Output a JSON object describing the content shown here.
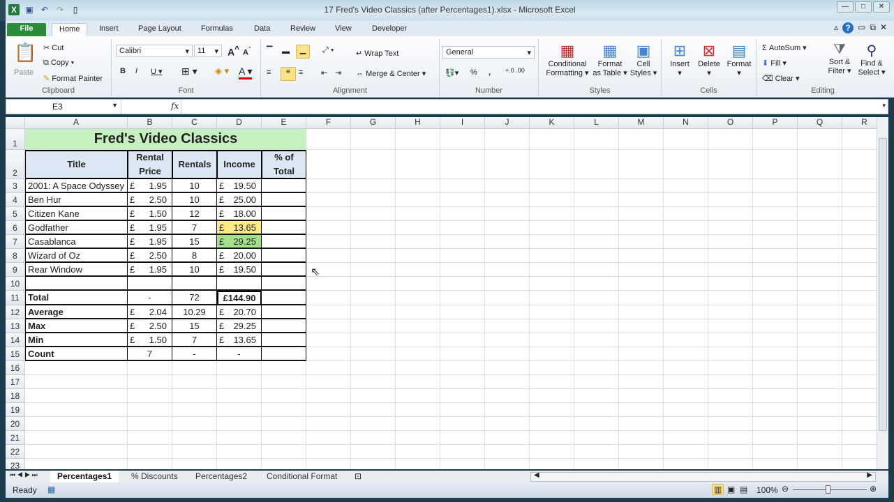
{
  "window": {
    "title": "17 Fred's Video Classics (after Percentages1).xlsx - Microsoft Excel"
  },
  "ribbon_tabs": [
    "File",
    "Home",
    "Insert",
    "Page Layout",
    "Formulas",
    "Data",
    "Review",
    "View",
    "Developer"
  ],
  "clipboard": {
    "paste": "Paste",
    "cut": "Cut",
    "copy": "Copy",
    "format_painter": "Format Painter",
    "label": "Clipboard"
  },
  "font": {
    "name": "Calibri",
    "size": "11",
    "label": "Font"
  },
  "alignment": {
    "wrap": "Wrap Text",
    "merge": "Merge & Center",
    "label": "Alignment"
  },
  "number": {
    "format": "General",
    "percent": "%",
    "comma": ",",
    "label": "Number"
  },
  "styles": {
    "conditional": "Conditional",
    "conditional2": "Formatting",
    "format_table": "Format",
    "format_table2": "as Table",
    "cell_styles": "Cell",
    "cell_styles2": "Styles",
    "label": "Styles"
  },
  "cells": {
    "insert": "Insert",
    "delete": "Delete",
    "format": "Format",
    "label": "Cells"
  },
  "editing": {
    "autosum": "AutoSum",
    "fill": "Fill",
    "clear": "Clear",
    "sort": "Sort &",
    "sort2": "Filter",
    "find": "Find &",
    "find2": "Select",
    "label": "Editing"
  },
  "formula_bar": {
    "name_box": "E3",
    "fx": "fx",
    "value": ""
  },
  "columns": [
    "A",
    "B",
    "C",
    "D",
    "E",
    "F",
    "G",
    "H",
    "I",
    "J",
    "K",
    "L",
    "M",
    "N",
    "O",
    "P",
    "Q",
    "R"
  ],
  "currency": "£",
  "sheet": {
    "title": "Fred's Video Classics",
    "headers": [
      "Title",
      "Rental Price",
      "Rentals",
      "Income",
      "% of Total"
    ],
    "rows": [
      [
        "2001: A Space Odyssey",
        "1.95",
        "10",
        "19.50",
        ""
      ],
      [
        "Ben Hur",
        "2.50",
        "10",
        "25.00",
        ""
      ],
      [
        "Citizen Kane",
        "1.50",
        "12",
        "18.00",
        ""
      ],
      [
        "Godfather",
        "1.95",
        "7",
        "13.65",
        ""
      ],
      [
        "Casablanca",
        "1.95",
        "15",
        "29.25",
        ""
      ],
      [
        "Wizard of Oz",
        "2.50",
        "8",
        "20.00",
        ""
      ],
      [
        "Rear Window",
        "1.95",
        "10",
        "19.50",
        ""
      ],
      [
        "",
        "",
        "",
        "",
        ""
      ],
      [
        "Total",
        "-",
        "72",
        "£144.90",
        ""
      ],
      [
        "Average",
        "2.04",
        "10.29",
        "20.70",
        ""
      ],
      [
        "Max",
        "2.50",
        "15",
        "29.25",
        ""
      ],
      [
        "Min",
        "1.50",
        "7",
        "13.65",
        ""
      ],
      [
        "Count",
        "7",
        "-",
        "-",
        ""
      ]
    ],
    "highlight_colors": {
      "min": "#ffeb84",
      "max": "#a6e08c",
      "title_bg": "#c7f0c0",
      "header_bg": "#dbe7f2"
    }
  },
  "sheet_tabs": [
    "Percentages1",
    "% Discounts",
    "Percentages2",
    "Conditional Format"
  ],
  "status": {
    "mode": "Ready",
    "zoom": "100%"
  }
}
